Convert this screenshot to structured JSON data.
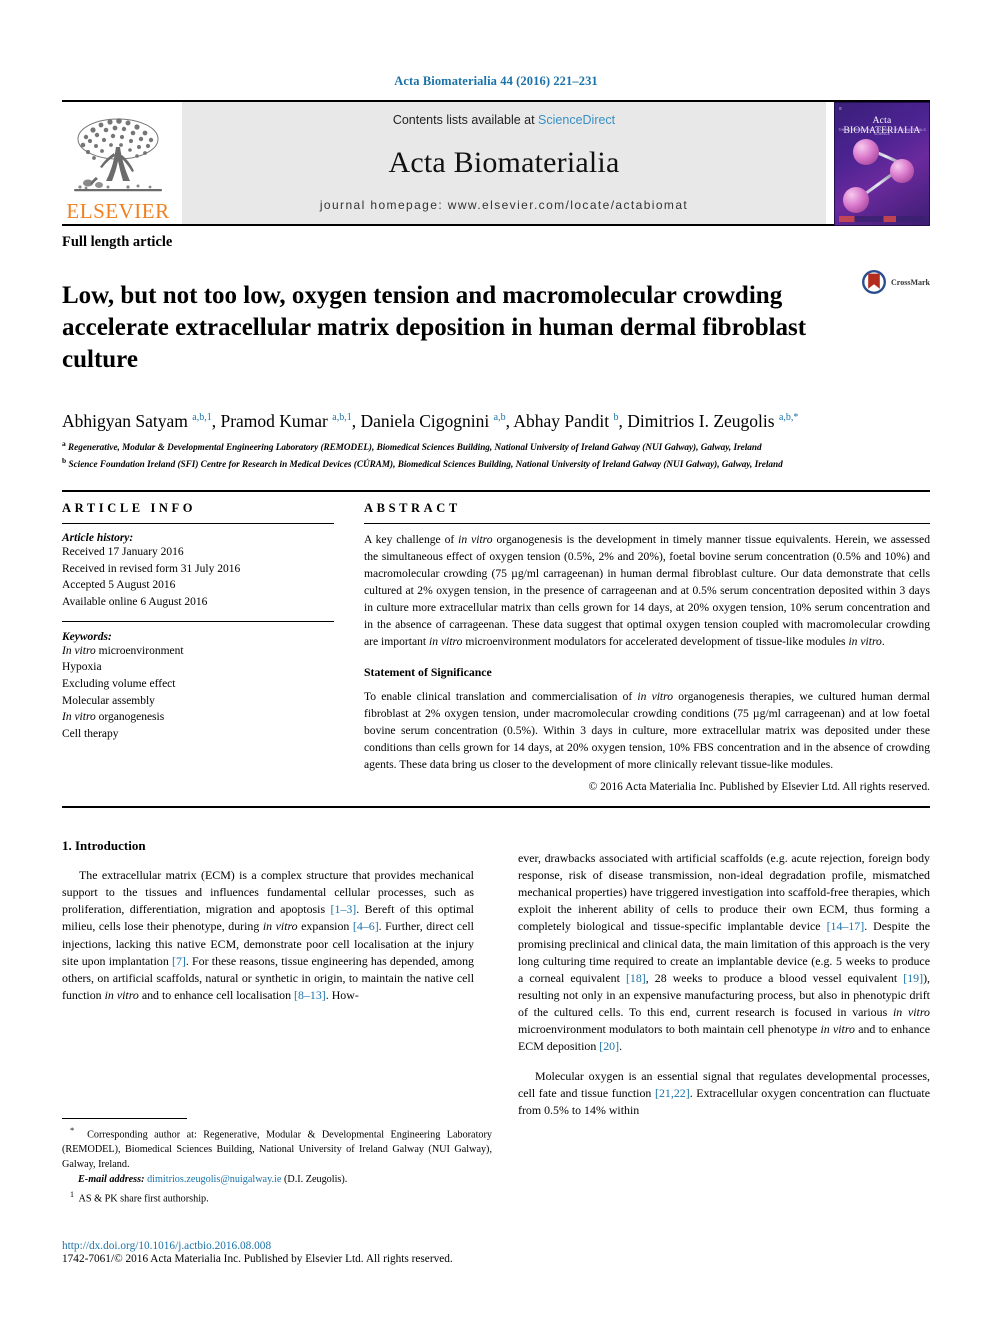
{
  "running_head": "Acta Biomaterialia 44 (2016) 221–231",
  "masthead": {
    "elsevier_wordmark": "ELSEVIER",
    "contents_prefix": "Contents lists available at ",
    "sciencedirect": "ScienceDirect",
    "journal_title": "Acta Biomaterialia",
    "homepage": "journal homepage: www.elsevier.com/locate/actabiomat",
    "cover": {
      "title": "Acta BIOMATERIALIA",
      "subtitle": "THE INTERNATIONAL JOURNAL OF BIOMATERIALS SCIENCE"
    }
  },
  "article": {
    "type": "Full length article",
    "title": "Low, but not too low, oxygen tension and macromolecular crowding accelerate extracellular matrix deposition in human dermal fibroblast culture",
    "crossmark_label": "CrossMark",
    "authors_html": "Abhigyan Satyam <sup>a,b,1</sup>, Pramod Kumar <sup>a,b,1</sup>, Daniela Cigognini <sup>a,b</sup>, Abhay Pandit <sup>b</sup>, Dimitrios I. Zeugolis <sup>a,b,</sup><sup>*</sup>",
    "affiliations": [
      "Regenerative, Modular & Developmental Engineering Laboratory (REMODEL), Biomedical Sciences Building, National University of Ireland Galway (NUI Galway), Galway, Ireland",
      "Science Foundation Ireland (SFI) Centre for Research in Medical Devices (CÚRAM), Biomedical Sciences Building, National University of Ireland Galway (NUI Galway), Galway, Ireland"
    ],
    "affiliation_marks": [
      "a",
      "b"
    ]
  },
  "info": {
    "heading": "ARTICLE INFO",
    "history_label": "Article history:",
    "history": [
      "Received 17 January 2016",
      "Received in revised form 31 July 2016",
      "Accepted 5 August 2016",
      "Available online 6 August 2016"
    ],
    "keywords_label": "Keywords:",
    "keywords_html": [
      "<i>In vitro</i> microenvironment",
      "Hypoxia",
      "Excluding volume effect",
      "Molecular assembly",
      "<i>In vitro</i> organogenesis",
      "Cell therapy"
    ]
  },
  "abstract": {
    "heading": "ABSTRACT",
    "body_html": "A key challenge of <i>in vitro</i> organogenesis is the development in timely manner tissue equivalents. Herein, we assessed the simultaneous effect of oxygen tension (0.5%, 2% and 20%), foetal bovine serum concentration (0.5% and 10%) and macromolecular crowding (75 µg/ml carrageenan) in human dermal fibroblast culture. Our data demonstrate that cells cultured at 2% oxygen tension, in the presence of carrageenan and at 0.5% serum concentration deposited within 3 days in culture more extracellular matrix than cells grown for 14 days, at 20% oxygen tension, 10% serum concentration and in the absence of carrageenan. These data suggest that optimal oxygen tension coupled with macromolecular crowding are important <i>in vitro</i> microenvironment modulators for accelerated development of tissue-like modules <i>in vitro</i>.",
    "significance_title": "Statement of Significance",
    "significance_html": "To enable clinical translation and commercialisation of <i>in vitro</i> organogenesis therapies, we cultured human dermal fibroblast at 2% oxygen tension, under macromolecular crowding conditions (75 µg/ml carrageenan) and at low foetal bovine serum concentration (0.5%). Within 3 days in culture, more extracellular matrix was deposited under these conditions than cells grown for 14 days, at 20% oxygen tension, 10% FBS concentration and in the absence of crowding agents. These data bring us closer to the development of more clinically relevant tissue-like modules.",
    "copyright": "© 2016 Acta Materialia Inc. Published by Elsevier Ltd. All rights reserved."
  },
  "introduction": {
    "heading": "1. Introduction",
    "left_paragraph_html": "The extracellular matrix (ECM) is a complex structure that provides mechanical support to the tissues and influences fundamental cellular processes, such as proliferation, differentiation, migration and apoptosis <span class=\"ref\">[1–3]</span>. Bereft of this optimal milieu, cells lose their phenotype, during <i>in vitro</i> expansion <span class=\"ref\">[4–6]</span>. Further, direct cell injections, lacking this native ECM, demonstrate poor cell localisation at the injury site upon implantation <span class=\"ref\">[7]</span>. For these reasons, tissue engineering has depended, among others, on artificial scaffolds, natural or synthetic in origin, to maintain the native cell function <i>in vitro</i> and to enhance cell localisation <span class=\"ref\">[8–13]</span>. How-",
    "right_paragraph_html": "ever, drawbacks associated with artificial scaffolds (e.g. acute rejection, foreign body response, risk of disease transmission, non-ideal degradation profile, mismatched mechanical properties) have triggered investigation into scaffold-free therapies, which exploit the inherent ability of cells to produce their own ECM, thus forming a completely biological and tissue-specific implantable device <span class=\"ref\">[14–17]</span>. Despite the promising preclinical and clinical data, the main limitation of this approach is the very long culturing time required to create an implantable device (e.g. 5 weeks to produce a corneal equivalent <span class=\"ref\">[18]</span>, 28 weeks to produce a blood vessel equivalent <span class=\"ref\">[19]</span>), resulting not only in an expensive manufacturing process, but also in phenotypic drift of the cultured cells. To this end, current research is focused in various <i>in vitro</i> microenvironment modulators to both maintain cell phenotype <i>in vitro</i> and to enhance ECM deposition <span class=\"ref\">[20]</span>.",
    "right_paragraph2_html": "Molecular oxygen is an essential signal that regulates developmental processes, cell fate and tissue function <span class=\"ref\">[21,22]</span>. Extracellular oxygen concentration can fluctuate from 0.5% to 14% within"
  },
  "footnotes": {
    "corresponding_html": "<sup>*</sup>&nbsp; Corresponding author at: Regenerative, Modular & Developmental Engineering Laboratory (REMODEL), Biomedical Sciences Building, National University of Ireland Galway (NUI Galway), Galway, Ireland.",
    "email_html": "<i>E-mail address:</i> <span class=\"link\">dimitrios.zeugolis@nuigalway.ie</span> (D.I. Zeugolis).",
    "share_html": "<sup>1</sup>&nbsp; AS &amp; PK share first authorship."
  },
  "doi_block": {
    "doi": "http://dx.doi.org/10.1016/j.actbio.2016.08.008",
    "issn": "1742-7061/© 2016 Acta Materialia Inc. Published by Elsevier Ltd. All rights reserved."
  },
  "colors": {
    "link_blue": "#1a72a8",
    "sciencedirect_blue": "#3a8fc4",
    "elsevier_orange": "#f08020",
    "crossmark_red": "#b32c1e",
    "crossmark_blue": "#2b4f8e",
    "banner_gray": "#e8e8e8"
  }
}
